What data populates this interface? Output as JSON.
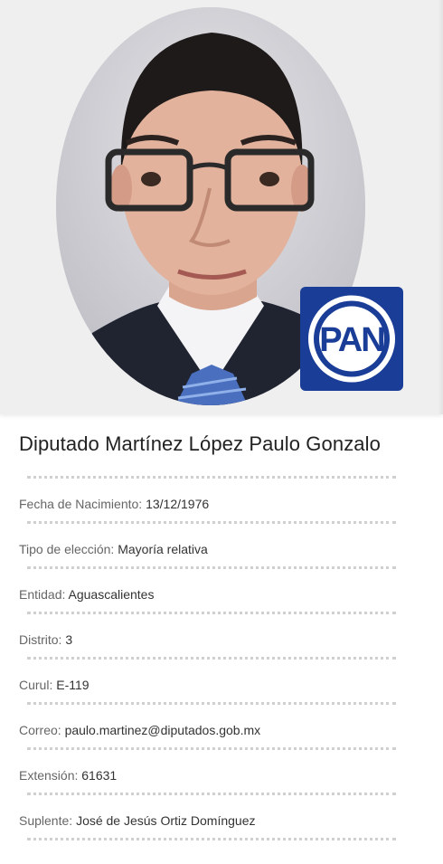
{
  "profile": {
    "name": "Diputado Martínez López Paulo Gonzalo",
    "party_logo_text": "PAN",
    "party_color": "#1a3d97",
    "fields": [
      {
        "label": "Fecha de Nacimiento:",
        "value": "13/12/1976"
      },
      {
        "label": "Tipo de elección:",
        "value": "Mayoría relativa"
      },
      {
        "label": "Entidad:",
        "value": "Aguascalientes"
      },
      {
        "label": "Distrito:",
        "value": "3"
      },
      {
        "label": "Curul:",
        "value": "E-119"
      },
      {
        "label": "Correo:",
        "value": "paulo.martinez@diputados.gob.mx"
      },
      {
        "label": "Extensión:",
        "value": "61631"
      },
      {
        "label": "Suplente:",
        "value": "José de Jesús Ortiz Domínguez"
      }
    ]
  }
}
